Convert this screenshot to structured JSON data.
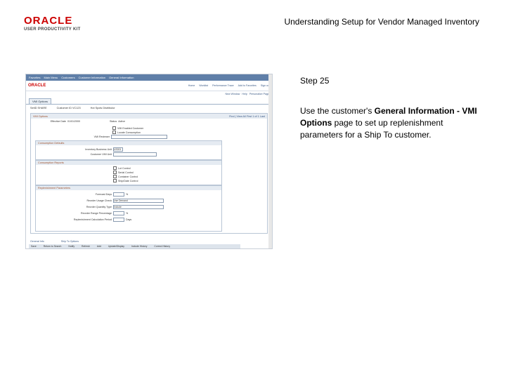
{
  "logo": {
    "oracle": "ORACLE",
    "upk": "USER PRODUCTIVITY KIT"
  },
  "doc_title": "Understanding Setup for Vendor Managed Inventory",
  "step": "Step 25",
  "instruction": {
    "before": "Use the customer's ",
    "bold": "General Information - VMI Options",
    "after": " page to set up replenishment parameters for a Ship To customer."
  },
  "screenshot": {
    "nav": [
      "Favorites",
      "Main Menu",
      "Customers",
      "Customer Information",
      "General Information"
    ],
    "brand": "ORACLE",
    "top_links": [
      "Home",
      "Worklist",
      "Performance Trace",
      "Add to Favorites",
      "Sign out"
    ],
    "util": [
      "New Window",
      "Help",
      "Personalize Page"
    ],
    "tab": "VMI Options",
    "header": [
      "SetID SHARE",
      "Customer ID VC123",
      "Hot Spots Distributor"
    ],
    "box_title": "VMI Options",
    "box_nav": "Find | View All   First 1 of 1 Last",
    "effective_date_label": "Effective Date",
    "effective_date": "01/01/2000",
    "status_label": "Status",
    "status": "Active",
    "chk1": "VMI Enabled Customer",
    "chk2": "Locate Consumption",
    "vmi_reviewer_label": "VMI Reviewer",
    "sec_consumption": "Consumption Defaults",
    "inventory_bu_label": "Inventory Business Unit",
    "inventory_bu": "US001",
    "customer_uom_label": "Customer VMI Unit",
    "sec_ship_to": "Consumption Reports",
    "reports": [
      "Lot Control",
      "Serial Control",
      "Container Control",
      "Ship/Date Control"
    ],
    "sec_replen": "Replenishment Parameters",
    "replen_rows": [
      {
        "label": "Forecast Days",
        "value": "%"
      },
      {
        "label": "Reorder Usage Check",
        "value": "Use Demand"
      },
      {
        "label": "Reorder Quantity Type",
        "value": "Include"
      },
      {
        "label": "Reorder Range Percentage",
        "value": "%"
      },
      {
        "label": "Replenishment Calculation Period",
        "value": "Days"
      }
    ],
    "footer_links": [
      "General Info",
      "Ship To Options"
    ],
    "buttons": [
      "Save",
      "Return to Search",
      "Notify",
      "Refresh",
      "Add",
      "Update/Display",
      "Include History",
      "Correct History"
    ]
  }
}
